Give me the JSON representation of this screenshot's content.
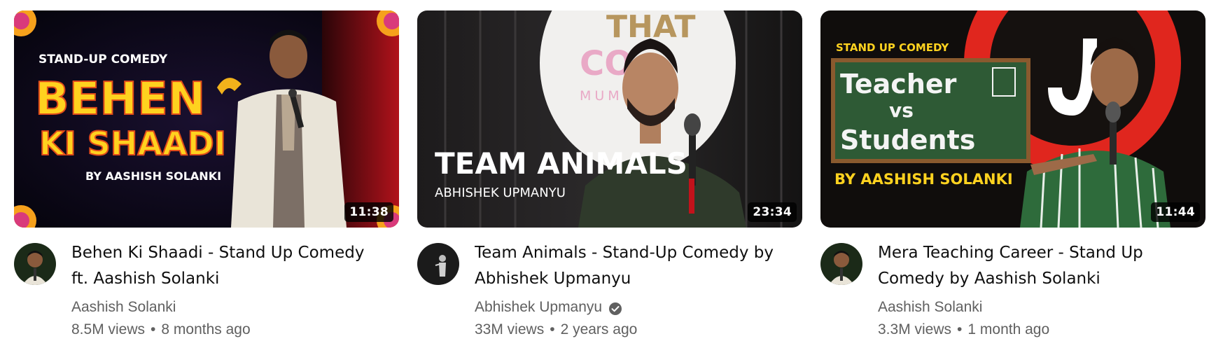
{
  "videos": [
    {
      "title": "Behen Ki Shaadi - Stand Up Comedy ft. Aashish Solanki",
      "channel": "Aashish Solanki",
      "verified": false,
      "views": "8.5M views",
      "age": "8 months ago",
      "duration": "11:38",
      "thumb_text": {
        "top": "STAND-UP COMEDY",
        "line1": "BEHEN",
        "line2": "KI SHAADI",
        "byline": "BY AASHISH SOLANKI"
      }
    },
    {
      "title": "Team Animals - Stand-Up Comedy by Abhishek Upmanyu",
      "channel": "Abhishek Upmanyu",
      "verified": true,
      "views": "33M views",
      "age": "2 years ago",
      "duration": "23:34",
      "thumb_text": {
        "title": "TEAM ANIMALS",
        "byline": "ABHISHEK UPMANYU"
      }
    },
    {
      "title": "Mera Teaching Career - Stand Up Comedy by Aashish Solanki",
      "channel": "Aashish Solanki",
      "verified": false,
      "views": "3.3M views",
      "age": "1 month ago",
      "duration": "11:44",
      "thumb_text": {
        "top": "STAND UP COMEDY",
        "line1": "Teacher",
        "line2": "vs",
        "line3": "Students",
        "byline": "BY AASHISH SOLANKI"
      }
    }
  ],
  "separator": "•",
  "icons": {
    "verified": "verified-check-icon"
  }
}
